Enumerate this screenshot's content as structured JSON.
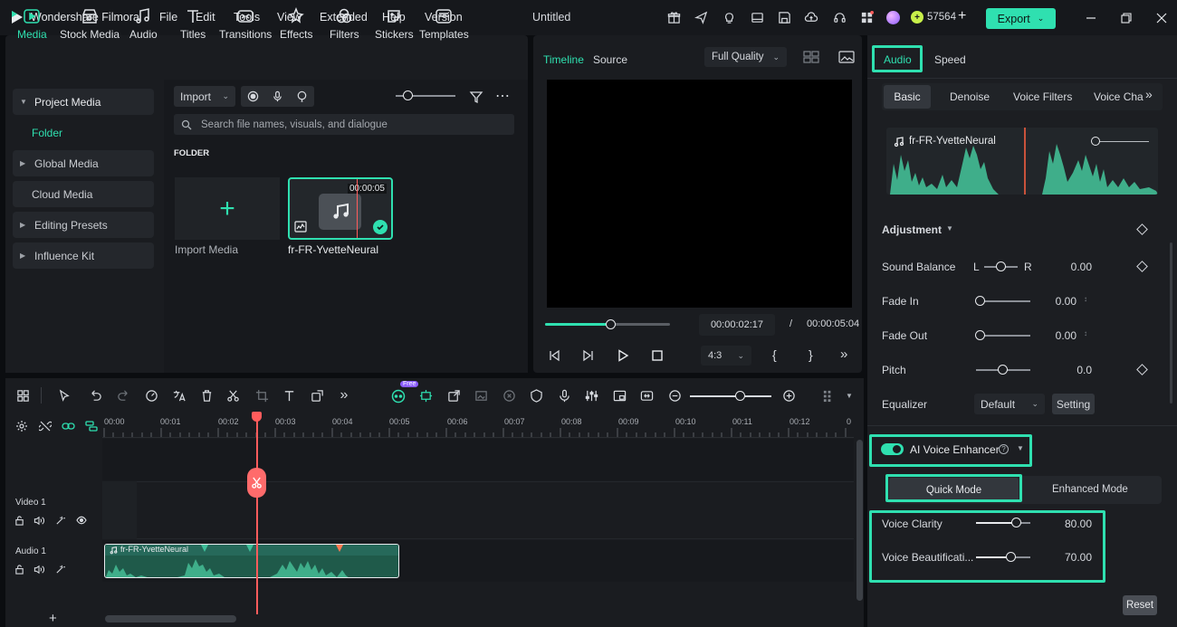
{
  "app": {
    "name": "Wondershare Filmora",
    "doc_title": "Untitled"
  },
  "menu": [
    "File",
    "Edit",
    "Tools",
    "View",
    "Extended",
    "Help",
    "Version"
  ],
  "credits": "57564",
  "export_label": "Export",
  "media_tabs": [
    {
      "label": "Media",
      "icon": "media-icon"
    },
    {
      "label": "Stock Media",
      "icon": "stock-media-icon"
    },
    {
      "label": "Audio",
      "icon": "audio-icon"
    },
    {
      "label": "Titles",
      "icon": "titles-icon"
    },
    {
      "label": "Transitions",
      "icon": "transitions-icon"
    },
    {
      "label": "Effects",
      "icon": "effects-icon"
    },
    {
      "label": "Filters",
      "icon": "filters-icon"
    },
    {
      "label": "Stickers",
      "icon": "stickers-icon"
    },
    {
      "label": "Templates",
      "icon": "templates-icon"
    }
  ],
  "side_nav": {
    "project_media": "Project Media",
    "folder": "Folder",
    "global_media": "Global Media",
    "cloud_media": "Cloud Media",
    "editing_presets": "Editing Presets",
    "influence_kit": "Influence Kit"
  },
  "media": {
    "import_label": "Import",
    "search_placeholder": "Search file names, visuals, and dialogue",
    "folder_heading": "FOLDER",
    "import_media_label": "Import Media",
    "clip_name": "fr-FR-YvetteNeural",
    "clip_duration": "00:00:05"
  },
  "preview": {
    "tab_timeline": "Timeline",
    "tab_source": "Source",
    "quality": "Full Quality",
    "current_time": "00:00:02:17",
    "separator": "/",
    "total_time": "00:00:05:04",
    "aspect": "4:3",
    "progress": 0.52
  },
  "right": {
    "tab_audio": "Audio",
    "tab_speed": "Speed",
    "subtabs": [
      "Basic",
      "Denoise",
      "Voice Filters",
      "Voice Cha"
    ],
    "waveform_name": "fr-FR-YvetteNeural",
    "adjustment": "Adjustment",
    "sound_balance": {
      "label": "Sound Balance",
      "left": "L",
      "right": "R",
      "value": "0.00"
    },
    "fade_in": {
      "label": "Fade In",
      "value": "0.00"
    },
    "fade_out": {
      "label": "Fade Out",
      "value": "0.00"
    },
    "pitch": {
      "label": "Pitch",
      "value": "0.0"
    },
    "equalizer": {
      "label": "Equalizer",
      "value": "Default",
      "setting": "Setting"
    },
    "ai_voice_enhancer": "AI Voice Enhancer",
    "quick_mode": "Quick Mode",
    "enhanced_mode": "Enhanced Mode",
    "voice_clarity": {
      "label": "Voice Clarity",
      "value": "80.00"
    },
    "voice_beautification": {
      "label": "Voice Beautificati...",
      "value": "70.00"
    },
    "reset": "Reset"
  },
  "timeline": {
    "ruler": [
      "00:00",
      "00:01",
      "00:02",
      "00:03",
      "00:04",
      "00:05",
      "00:06",
      "00:07",
      "00:08",
      "00:09",
      "00:10",
      "00:11",
      "00:12",
      "0"
    ],
    "video_track": "Video 1",
    "audio_track": "Audio 1",
    "clip_name": "fr-FR-YvetteNeural",
    "free_badge": "Free"
  },
  "colors": {
    "accent": "#2fe0b0",
    "playhead": "#ff5c5c",
    "audio_clip": "#1f5a4a"
  }
}
